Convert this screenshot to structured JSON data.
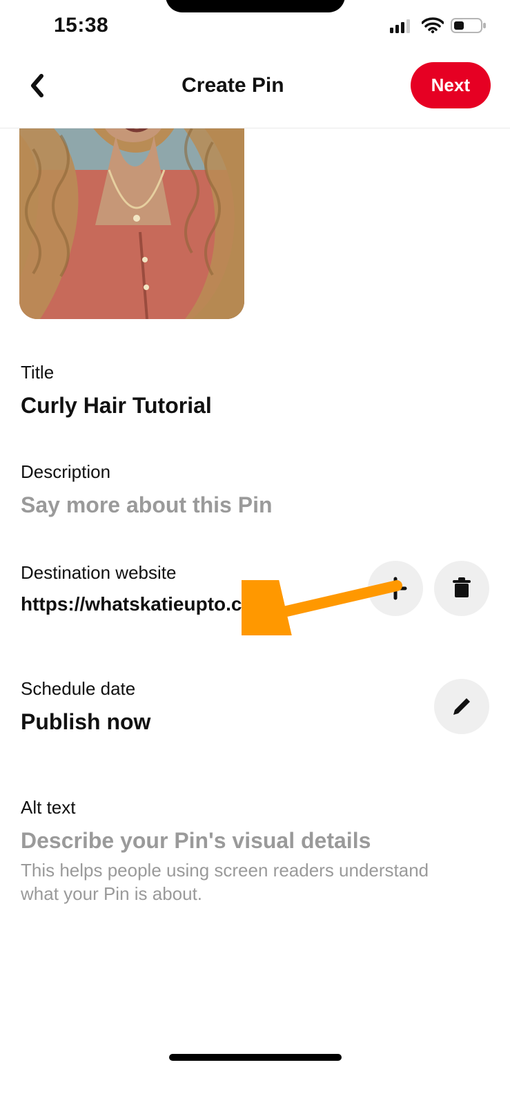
{
  "status": {
    "time": "15:38"
  },
  "header": {
    "title": "Create Pin",
    "next_label": "Next"
  },
  "fields": {
    "title": {
      "label": "Title",
      "value": "Curly Hair Tutorial"
    },
    "description": {
      "label": "Description",
      "placeholder": "Say more about this Pin"
    },
    "destination": {
      "label": "Destination website",
      "url": "https://whatskatieupto.com/"
    },
    "schedule": {
      "label": "Schedule date",
      "value": "Publish now"
    },
    "alttext": {
      "label": "Alt text",
      "placeholder": "Describe your Pin's visual details",
      "help": "This helps people using screen readers understand what your Pin is about."
    }
  },
  "colors": {
    "accent": "#e60023",
    "arrow": "#ff9800"
  }
}
